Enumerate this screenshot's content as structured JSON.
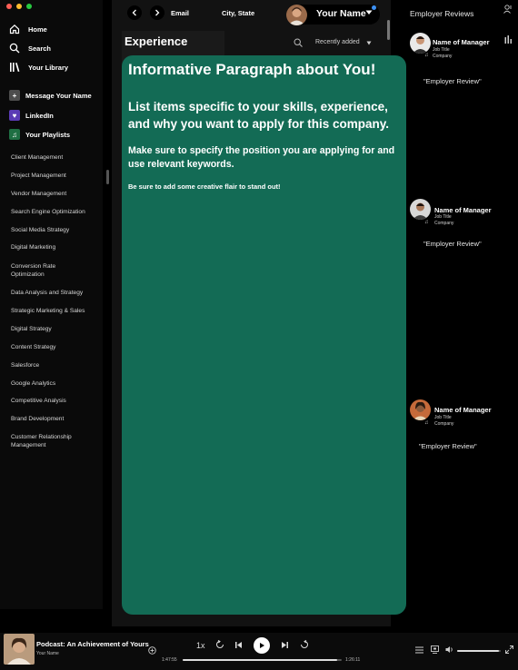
{
  "window": {
    "traffic_light_colors": [
      "#ff5f57",
      "#febc2e",
      "#28c840"
    ]
  },
  "sidebar": {
    "nav": [
      {
        "label": "Home",
        "icon": "home-icon"
      },
      {
        "label": "Search",
        "icon": "search-icon"
      },
      {
        "label": "Your Library",
        "icon": "library-icon"
      }
    ],
    "library_items": [
      {
        "label": "Message Your Name",
        "icon": "plus-icon",
        "color": "#4d4d4d"
      },
      {
        "label": "LinkedIn",
        "icon": "heart-icon",
        "color": "#5b3bb5"
      },
      {
        "label": "Your Playlists",
        "icon": "playlist-icon",
        "color": "#1f6f43"
      }
    ],
    "skills": [
      "Client Management",
      "Project Management",
      "Vendor Management",
      "Search Engine Optimization",
      "Social Media Strategy",
      "Digital Marketing",
      "Conversion Rate Optimization",
      "Data Analysis and Strategy",
      "Strategic Marketing & Sales",
      "Digital Strategy",
      "Content Strategy",
      "Salesforce",
      "Google Analytics",
      "Competitive Analysis",
      "Brand Development",
      "Customer Relationship Management"
    ]
  },
  "topbar": {
    "back_icon": "chevron-left-icon",
    "forward_icon": "chevron-right-icon",
    "email": "Email",
    "location": "City, State",
    "user_name": "Your Name",
    "notification_color": "#3d91f4"
  },
  "library_header": {
    "title": "Experience",
    "sort_label": "Recently added"
  },
  "content_card": {
    "background": "#136b55",
    "heading": "Informative Paragraph about You!",
    "paragraph_1": "List items specific to your skills, experience, and why you want to apply for this company.",
    "paragraph_2": "Make sure to specify the position you are applying for and use relevant keywords.",
    "paragraph_3": "Be sure to add some creative flair to stand out!"
  },
  "right_panel": {
    "title": "Employer Reviews",
    "reviews": [
      {
        "name": "Name of Manager",
        "job_title": "Job Title",
        "company": "Company",
        "review": "\"Employer Review\""
      },
      {
        "name": "Name of Manager",
        "job_title": "Job Title",
        "company": "Company",
        "review": "\"Employer Review\""
      },
      {
        "name": "Name of Manager",
        "job_title": "Job Title",
        "company": "Company",
        "review": "\"Employer Review\""
      }
    ]
  },
  "player": {
    "track_title": "Podcast: An Achievement of Yours",
    "track_artist": "Your Name",
    "speed": "1x",
    "elapsed": "1:47:55",
    "remaining": "1:26:11",
    "progress_fraction": 0.97,
    "volume_fraction": 0.95
  }
}
